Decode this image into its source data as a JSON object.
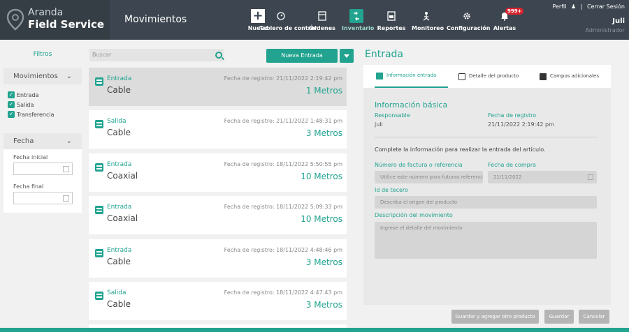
{
  "brand": {
    "line1": "Aranda",
    "line2": "Field Service"
  },
  "page_title": "Movimientos",
  "nav": [
    {
      "label": "Nuevo",
      "icon": "plus-icon"
    },
    {
      "label": "Tablero de control",
      "icon": "dashboard-icon"
    },
    {
      "label": "Órdenes",
      "icon": "orders-icon"
    },
    {
      "label": "Inventario",
      "icon": "inventory-icon"
    },
    {
      "label": "Reportes",
      "icon": "reports-icon"
    },
    {
      "label": "Monitoreo",
      "icon": "monitor-icon"
    },
    {
      "label": "Configuración",
      "icon": "gear-icon"
    },
    {
      "label": "Alertas",
      "icon": "bell-icon",
      "badge": "999+"
    }
  ],
  "user": {
    "perfil": "Perfil",
    "logout": "Cerrar Sesión",
    "name": "Juli",
    "role": "Administrador"
  },
  "filters": {
    "title": "Filtros",
    "movimientos": {
      "label": "Movimientos",
      "items": [
        "Entrada",
        "Salida",
        "Transferencia"
      ]
    },
    "fecha": {
      "label": "Fecha",
      "start_label": "Fecha inicial",
      "end_label": "Fecha final"
    }
  },
  "list": {
    "search_placeholder": "Buscar",
    "new_button": "Nueva Entrada",
    "items": [
      {
        "type": "Entrada",
        "name": "Cable",
        "date": "Fecha de registro: 21/11/2022 2:19:42 pm",
        "qty": "1 Metros"
      },
      {
        "type": "Salida",
        "name": "Cable",
        "date": "Fecha de registro: 21/11/2022 1:48:31 pm",
        "qty": "3 Metros"
      },
      {
        "type": "Entrada",
        "name": "Coaxial",
        "date": "Fecha de registro: 18/11/2022 5:50:55 pm",
        "qty": "10 Metros"
      },
      {
        "type": "Entrada",
        "name": "Coaxial",
        "date": "Fecha de registro: 18/11/2022 5:09:33 pm",
        "qty": "10 Metros"
      },
      {
        "type": "Entrada",
        "name": "Cable",
        "date": "Fecha de registro: 18/11/2022 4:48:46 pm",
        "qty": "3 Metros"
      },
      {
        "type": "Salida",
        "name": "Cable",
        "date": "Fecha de registro: 18/11/2022 4:47:43 pm",
        "qty": "3 Metros"
      }
    ]
  },
  "detail": {
    "title": "Entrada",
    "tabs": [
      "Información entrada",
      "Detalle del producto",
      "Campos adicionales"
    ],
    "section": "Información básica",
    "responsable_label": "Responsable",
    "responsable_value": "juli",
    "fecha_label": "Fecha de registro",
    "fecha_value": "21/11/2022 2:19:42 pm",
    "instruction": "Complete la información para realizar la entrada del artículo.",
    "factura_label": "Número de factura o referencia",
    "factura_placeholder": "Utilice este número para futuras referencias",
    "compra_label": "Fecha de compra",
    "compra_value": "21/11/2022",
    "tercero_label": "Id de tecero",
    "tercero_placeholder": "Describa el origen del producto",
    "desc_label": "Descripción del movimiento",
    "desc_placeholder": "Ingrese el detalle del movimiento"
  },
  "footer": {
    "save_add": "Guardar y agregar otro producto",
    "save": "Guardar",
    "cancel": "Cancelar"
  }
}
